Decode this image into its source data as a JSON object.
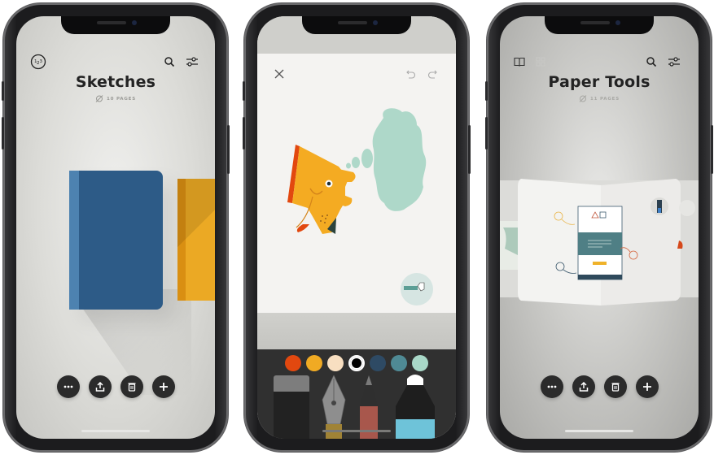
{
  "screens": [
    {
      "id": "library-sketches",
      "icons": {
        "left": [
          "numbering-icon"
        ],
        "right": [
          "search-icon",
          "filter-icon"
        ]
      },
      "title": "Sketches",
      "page_count": "10 PAGES",
      "notebooks": [
        {
          "name": "Sketches",
          "color": "#2d5b87",
          "spine_color": "#4d82b0"
        },
        {
          "name": "next-notebook",
          "color": "#eba924",
          "spine_color": "#d98f12"
        }
      ],
      "actions": [
        "more-icon",
        "share-icon",
        "trash-icon",
        "add-icon"
      ]
    },
    {
      "id": "drawing-canvas",
      "toolbar": {
        "close": "close-icon",
        "undo": "undo-icon",
        "redo": "redo-icon"
      },
      "palette": [
        {
          "name": "orange-red",
          "hex": "#e2480f",
          "selected": false
        },
        {
          "name": "amber",
          "hex": "#f0aa23",
          "selected": false
        },
        {
          "name": "cream",
          "hex": "#f8dfc1",
          "selected": false
        },
        {
          "name": "black",
          "hex": "#000000",
          "selected": true
        },
        {
          "name": "navy",
          "hex": "#2e4a64",
          "selected": false
        },
        {
          "name": "teal",
          "hex": "#4f8a95",
          "selected": false
        },
        {
          "name": "mint",
          "hex": "#a9d8c8",
          "selected": false
        }
      ],
      "tools": [
        "eraser",
        "fountain-pen",
        "pencil",
        "marker"
      ],
      "active_tool": "marker",
      "drawing": "dog-head-with-thought-cloud"
    },
    {
      "id": "library-paper-tools",
      "icons": {
        "left": [
          "book-view-icon",
          "grid-view-icon"
        ],
        "right": [
          "search-icon",
          "filter-icon"
        ]
      },
      "title": "Paper Tools",
      "page_count": "11 PAGES",
      "actions": [
        "more-icon",
        "share-icon",
        "trash-icon",
        "add-icon"
      ]
    }
  ]
}
